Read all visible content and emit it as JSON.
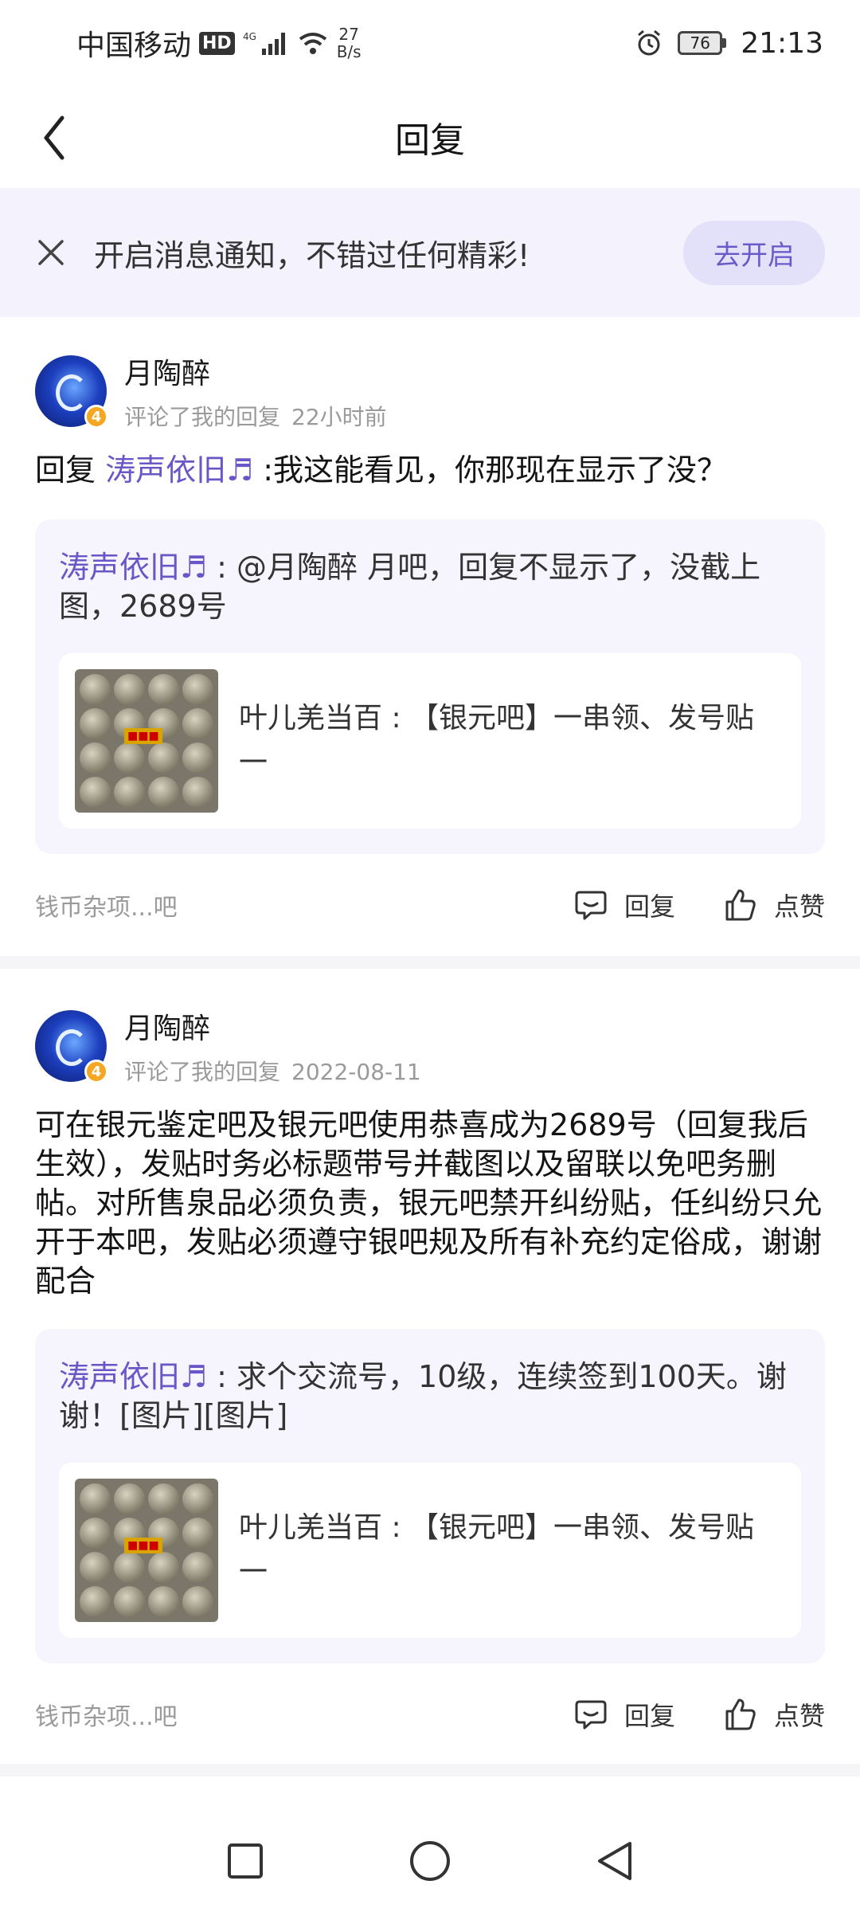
{
  "status_bar": {
    "carrier": "中国移动",
    "hd": "HD",
    "net_speed_value": "27",
    "net_speed_unit": "B/s",
    "battery": "76",
    "time": "21:13"
  },
  "nav": {
    "title": "回复"
  },
  "banner": {
    "text": "开启消息通知，不错过任何精彩!",
    "button": "去开启"
  },
  "cards": [
    {
      "username": "月陶醉",
      "level": "4",
      "action": "评论了我的回复",
      "time": "22小时前",
      "reply_prefix": "回复 ",
      "reply_target": "涛声依旧♬",
      "reply_text": " :我这能看见，你那现在显示了没？",
      "quote_author": "涛声依旧♬",
      "quote_text": " : @月陶醉 月吧，回复不显示了，没截上图，2689号",
      "source_text": "叶儿羌当百 : 【银元吧】一串领、发号贴一",
      "forum": "钱币杂项...吧",
      "reply_label": "回复",
      "like_label": "点赞"
    },
    {
      "username": "月陶醉",
      "level": "4",
      "action": "评论了我的回复",
      "time": "2022-08-11",
      "reply_text": "可在银元鉴定吧及银元吧使用恭喜成为2689号（回复我后生效），发贴时务必标题带号并截图以及留联以免吧务删帖。对所售泉品必须负责，银元吧禁开纠纷贴，任纠纷只允开于本吧，发贴必须遵守银吧规及所有补充约定俗成，谢谢配合",
      "quote_author": "涛声依旧♬",
      "quote_text": " : 求个交流号，10级，连续签到100天。谢谢！[图片][图片]",
      "source_text": "叶儿羌当百 : 【银元吧】一串领、发号贴一",
      "forum": "钱币杂项...吧",
      "reply_label": "回复",
      "like_label": "点赞"
    }
  ],
  "colors": {
    "accent": "#6a56c6",
    "banner_bg": "#f3f2fd",
    "quote_bg": "#f6f5fd",
    "muted": "#9a9a9a"
  }
}
